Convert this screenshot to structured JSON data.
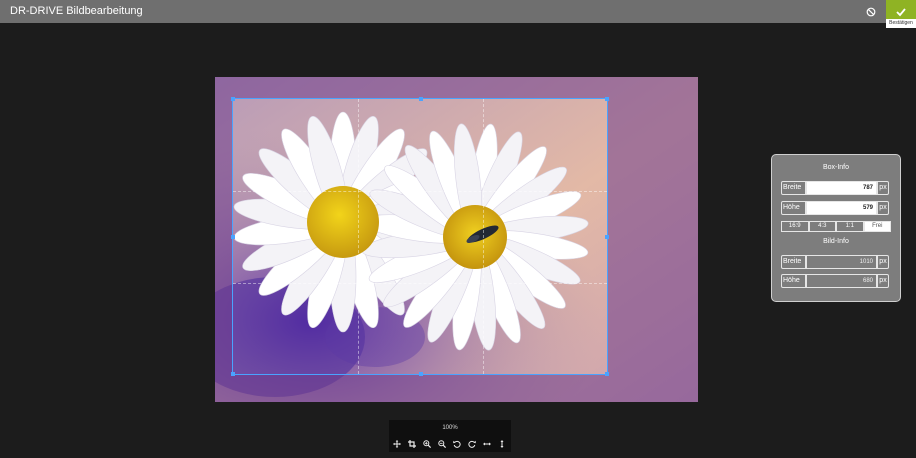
{
  "header": {
    "title": "DR-DRIVE Bildbearbeitung",
    "cancel_icon": "cancel-circle-icon",
    "confirm_icon": "check-icon",
    "confirm_tooltip": "Bestätigen",
    "accent_color": "#8fb324"
  },
  "info_panel": {
    "box_title": "Box-Info",
    "box_width_label": "Breite",
    "box_width_value": "787",
    "box_height_label": "Höhe",
    "box_height_value": "579",
    "unit": "px",
    "ratios": [
      "16:9",
      "4:3",
      "1:1",
      "Frei"
    ],
    "active_ratio": "Frei",
    "image_title": "Bild-Info",
    "image_width_label": "Breite",
    "image_width_value": "1010",
    "image_height_label": "Höhe",
    "image_height_value": "680"
  },
  "toolbar": {
    "zoom_level": "100%",
    "tools": [
      "move-icon",
      "crop-icon",
      "zoom-in-icon",
      "zoom-out-icon",
      "rotate-left-icon",
      "rotate-right-icon",
      "flip-horizontal-icon",
      "flip-vertical-icon"
    ]
  }
}
